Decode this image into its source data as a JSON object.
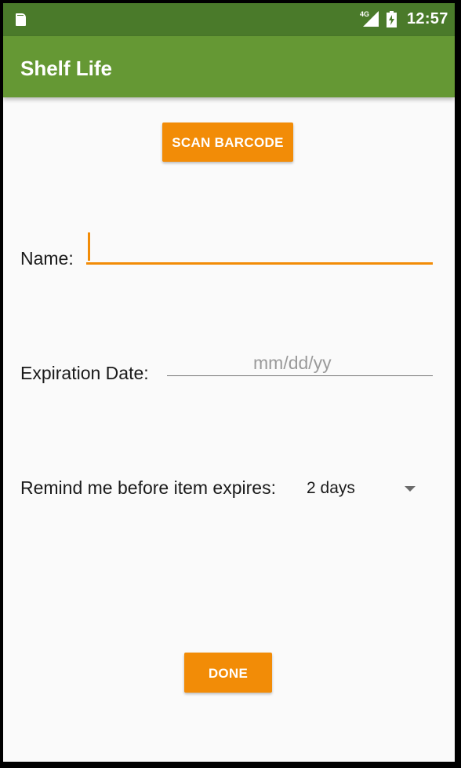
{
  "status_bar": {
    "network_label": "4G",
    "time": "12:57",
    "icons": [
      "sd-card-icon",
      "signal-icon",
      "battery-icon"
    ]
  },
  "app_bar": {
    "title": "Shelf Life"
  },
  "buttons": {
    "scan": "SCAN BARCODE",
    "done": "DONE"
  },
  "form": {
    "name_label": "Name:",
    "name_value": "",
    "expiration_label": "Expiration Date:",
    "expiration_placeholder": "mm/dd/yy",
    "remind_label": "Remind me before item expires:",
    "remind_value": "2 days"
  },
  "colors": {
    "status_bar": "#4a7a2a",
    "app_bar": "#659834",
    "accent": "#f28c07",
    "background": "#fafafa"
  }
}
